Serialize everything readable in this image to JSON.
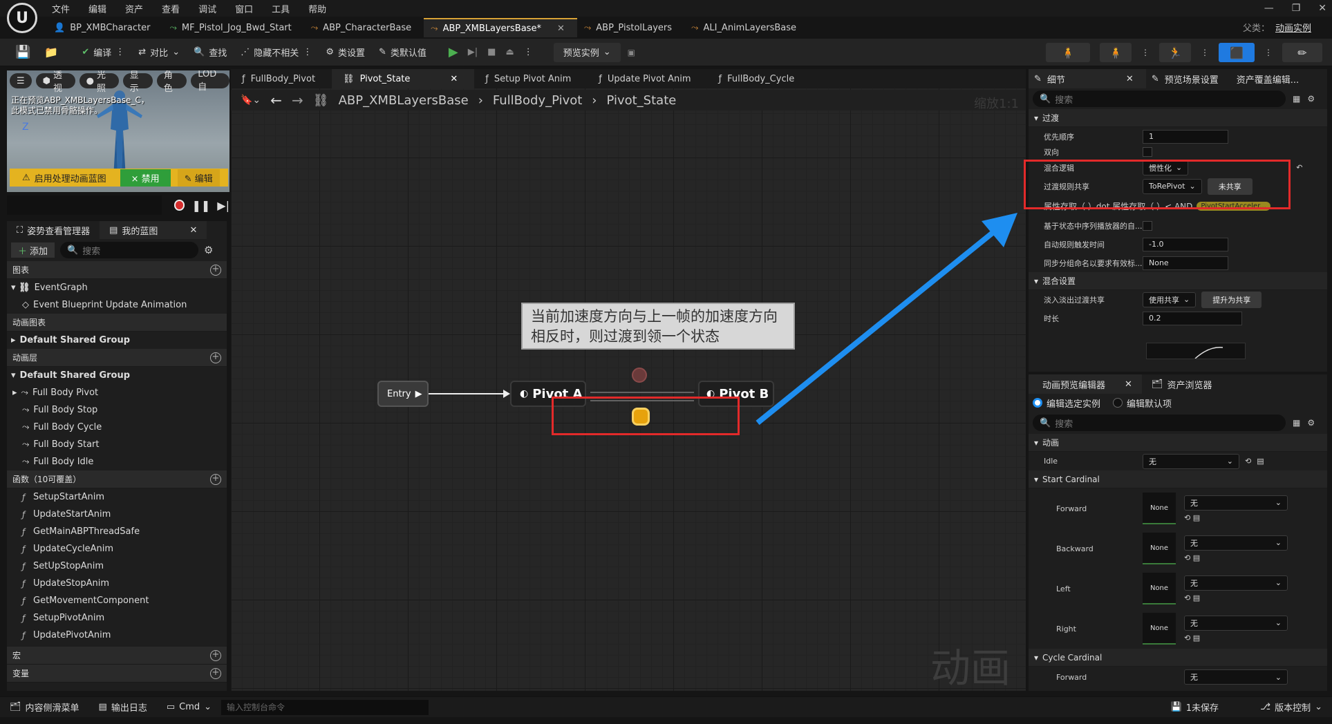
{
  "menubar": {
    "items": [
      "文件",
      "编辑",
      "资产",
      "查看",
      "调试",
      "窗口",
      "工具",
      "帮助"
    ]
  },
  "doc_tabs": [
    {
      "label": "BP_XMBCharacter",
      "icon": "person-icon"
    },
    {
      "label": "MF_Pistol_Jog_Bwd_Start",
      "icon": "anim-icon"
    },
    {
      "label": "ABP_CharacterBase",
      "icon": "anim-blueprint-icon"
    },
    {
      "label": "ABP_XMBLayersBase*",
      "icon": "anim-blueprint-icon",
      "active": true
    },
    {
      "label": "ABP_PistolLayers",
      "icon": "anim-blueprint-icon"
    },
    {
      "label": "ALI_AnimLayersBase",
      "icon": "anim-interface-icon"
    }
  ],
  "parent": {
    "label": "父类：",
    "value": "动画实例"
  },
  "toolbar": {
    "compile": "编译",
    "diff": "对比",
    "find": "查找",
    "hide_unrelated": "隐藏不相关",
    "class_settings": "类设置",
    "class_defaults": "类默认值",
    "preview_instance": "预览实例"
  },
  "viewport": {
    "pills": [
      "透视",
      "光照",
      "显示",
      "角色",
      "LOD自"
    ],
    "message": "正在预览ABP_XMBLayersBase_C，\n此模式已禁用骨骼操作。",
    "axis": "Z",
    "bar_label": "启用处理动画蓝图",
    "disable_label": "× 禁用",
    "edit_label": "编辑"
  },
  "left_panel": {
    "tab1": "姿势查看管理器",
    "tab2": "我的蓝图",
    "add": "添加",
    "search_placeholder": "搜索",
    "sections": {
      "graphs": "图表",
      "anim_graphs": "动画图表",
      "anim_layers": "动画层",
      "functions": "函数（10可覆盖）",
      "macros": "宏",
      "variables": "变量"
    },
    "event_graph": "EventGraph",
    "event_update": "Event Blueprint Update Animation",
    "default_group": "Default Shared Group",
    "layers": [
      "Full Body Pivot",
      "Full Body Stop",
      "Full Body Cycle",
      "Full Body Start",
      "Full Body Idle"
    ],
    "functions": [
      "SetupStartAnim",
      "UpdateStartAnim",
      "GetMainABPThreadSafe",
      "UpdateCycleAnim",
      "SetUpStopAnim",
      "UpdateStopAnim",
      "GetMovementComponent",
      "SetupPivotAnim",
      "UpdatePivotAnim"
    ]
  },
  "graph": {
    "tabs": [
      "FullBody_Pivot",
      "Pivot_State",
      "Setup Pivot Anim",
      "Update Pivot Anim",
      "FullBody_Cycle"
    ],
    "breadcrumb": [
      "ABP_XMBLayersBase",
      "FullBody_Pivot",
      "Pivot_State"
    ],
    "zoom": "缩放1:1",
    "comment": "当前加速度方向与上一帧的加速度方向相反时，则过渡到领一个状态",
    "entry": "Entry",
    "node_a": "Pivot A",
    "node_b": "Pivot B",
    "watermark": "动画"
  },
  "details": {
    "tab1": "细节",
    "tab2": "预览场景设置",
    "tab3": "资产覆盖编辑...",
    "search_placeholder": "搜索",
    "sec_transition": "过渡",
    "priority_label": "优先顺序",
    "priority_value": "1",
    "bidir_label": "双向",
    "blend_logic_label": "混合逻辑",
    "blend_logic_value": "惯性化",
    "share_label": "过渡规则共享",
    "share_value": "ToRePivot",
    "unshared": "未共享",
    "rule_text": "属性存取（ ）dot 属性存取（ ）< AND",
    "rule_badge": "PivotStartAcceler...",
    "state_based_label": "基于状态中序列播放器的自...",
    "auto_time_label": "自动规则触发时间",
    "auto_time_value": "-1.0",
    "sync_label": "同步分组命名以要求有效标...",
    "sync_value": "None",
    "sec_blend": "混合设置",
    "crossfade_label": "淡入淡出过渡共享",
    "crossfade_value": "使用共享",
    "promote": "提升为共享",
    "duration_label": "时长",
    "duration_value": "0.2"
  },
  "anim_preview": {
    "tab1": "动画预览编辑器",
    "tab2": "资产浏览器",
    "radio1": "编辑选定实例",
    "radio2": "编辑默认项",
    "search_placeholder": "搜索",
    "sec_anim": "动画",
    "idle_label": "Idle",
    "none_option": "无",
    "thumb_none": "None",
    "start_cardinal": "Start Cardinal",
    "dirs": [
      "Forward",
      "Backward",
      "Left",
      "Right"
    ],
    "cycle_cardinal": "Cycle Cardinal",
    "cycle_first": "Forward"
  },
  "statusbar": {
    "content_drawer": "内容侧滑菜单",
    "output_log": "输出日志",
    "cmd": "Cmd",
    "cmd_placeholder": "输入控制台命令",
    "unsaved": "1未保存",
    "source_control": "版本控制"
  },
  "colors": {
    "accent": "#d9a336",
    "highlight_box": "#e32a2a",
    "arrow": "#1e8ef0",
    "play": "#4caf50"
  }
}
